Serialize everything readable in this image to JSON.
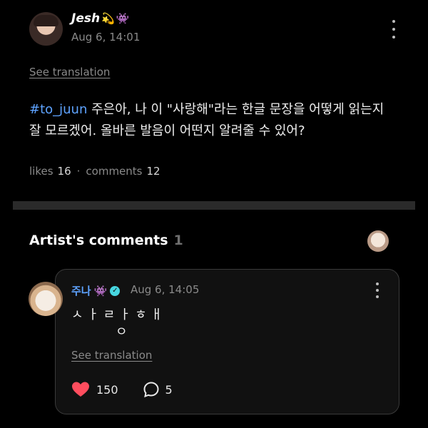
{
  "post": {
    "author": "Jesh",
    "author_emojis": [
      "💫",
      "👾"
    ],
    "date": "Aug 6, 14:01",
    "see_translation": "See translation",
    "hashtag": "#to_juun",
    "body_text": " 주은아, 나 이 \"사랑해\"라는 한글 문장을 어떻게 읽는지 잘 모르겠어. 올바른 발음이 어떤지 알려줄 수 있어?",
    "likes_label": "likes",
    "likes_count": "16",
    "separator": "·",
    "comments_label": "comments",
    "comments_count": "12",
    "more_icon": "more-vertical-icon"
  },
  "artist_comments": {
    "title": "Artist's comments",
    "count": "1"
  },
  "comment": {
    "author": "주나",
    "author_emoji": "👾",
    "verified_icon": "verified-check-icon",
    "date": "Aug 6, 14:05",
    "line1": "ㅅ ㅏ ㄹ ㅏ ㅎ ㅐ",
    "line2": "ㅇ",
    "see_translation": "See translation",
    "like_count": "150",
    "reply_count": "5",
    "heart_color": "#ff4d5e",
    "accent": "#5ea3ff"
  }
}
